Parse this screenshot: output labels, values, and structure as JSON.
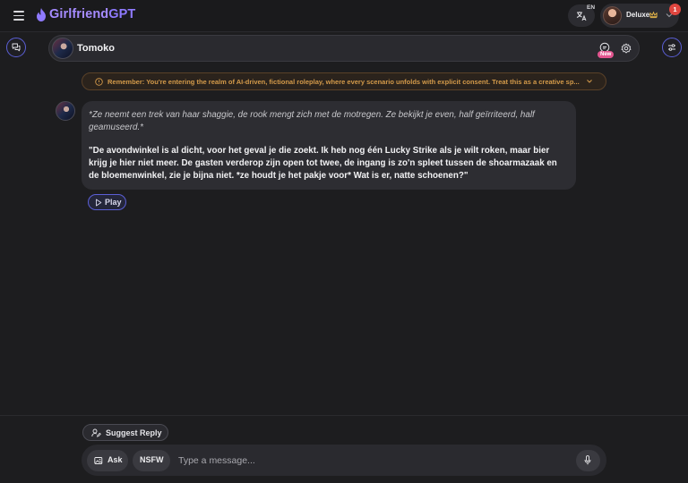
{
  "app": {
    "logo_brand": "Girlfriend",
    "logo_suffix": "GPT",
    "accent_color": "#8f7aff"
  },
  "topbar": {
    "language_code": "EN",
    "user_plan": "Deluxe",
    "notification_count": "1"
  },
  "chat": {
    "character_name": "Tomoko",
    "new_badge": "New",
    "disclaimer": "Remember: You're entering the realm of AI-driven, fictional roleplay, where every scenario unfolds with explicit consent. Treat this as a creative sp...",
    "messages": [
      {
        "action": "*Ze neemt een trek van haar shaggie, de rook mengt zich met de motregen. Ze bekijkt je even, half geïrriteerd, half geamuseerd.*",
        "speech": "\"De avondwinkel is al dicht, voor het geval je die zoekt. Ik heb nog één Lucky Strike als je wilt roken, maar bier krijg je hier niet meer. De gasten verderop zijn open tot twee, de ingang is zo'n spleet tussen de shoarmazaak en de bloemenwinkel, zie je bijna niet. *ze houdt je het pakje voor* Wat is er, natte schoenen?\""
      }
    ],
    "play_label": "Play"
  },
  "composer": {
    "suggest_label": "Suggest Reply",
    "ask_label": "Ask",
    "nsfw_label": "NSFW",
    "placeholder": "Type a message..."
  }
}
